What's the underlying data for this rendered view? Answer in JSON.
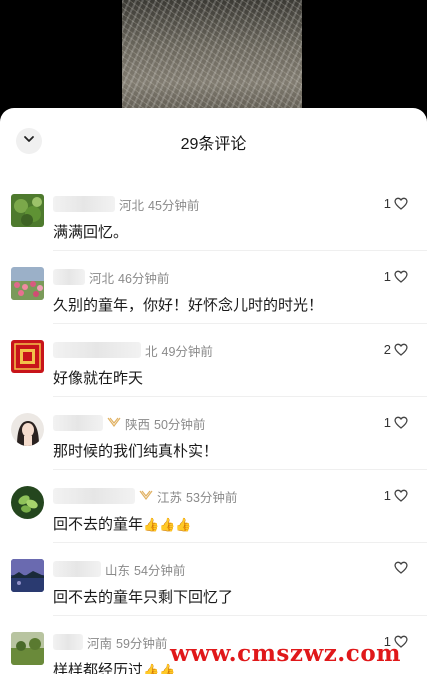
{
  "sheet": {
    "title": "29条评论"
  },
  "comments": [
    {
      "region": "河北",
      "time": "45分钟前",
      "text": "满满回忆。",
      "likes": "1",
      "avatar": "plant-avatar"
    },
    {
      "region": "河北",
      "time": "46分钟前",
      "text": "久别的童年，你好！好怀念儿时的时光！",
      "likes": "1",
      "avatar": "flowers-avatar"
    },
    {
      "region": "北",
      "time": "49分钟前",
      "text": "好像就在昨天",
      "likes": "2",
      "avatar": "red-seal-avatar"
    },
    {
      "region": "陕西",
      "time": "50分钟前",
      "text": "那时候的我们纯真朴实！",
      "likes": "1",
      "avatar": "girl-avatar"
    },
    {
      "region": "江苏",
      "time": "53分钟前",
      "text": "回不去的童年",
      "thumbs": "👍👍👍",
      "likes": "1",
      "avatar": "leaf-avatar"
    },
    {
      "region": "山东",
      "time": "54分钟前",
      "text": "回不去的童年只剩下回忆了",
      "likes": "",
      "avatar": "lake-avatar"
    },
    {
      "region": "河南",
      "time": "59分钟前",
      "text": "样样都经历过",
      "thumbs": "👍👍",
      "likes": "1",
      "avatar": "field-avatar"
    }
  ],
  "watermark": "www.cmszwz.com",
  "colors": {
    "like_outline": "#444444",
    "meta_text": "#8a8a8a",
    "watermark": "#e0181a",
    "badge_gold": "#e0b060"
  }
}
